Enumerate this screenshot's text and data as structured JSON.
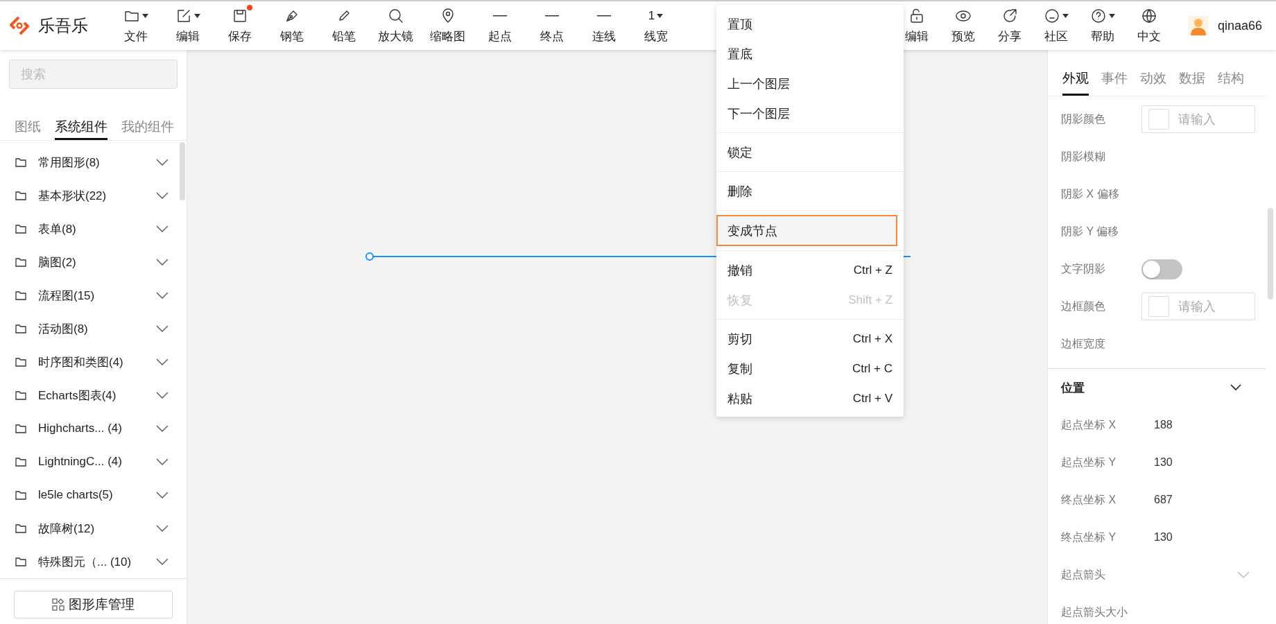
{
  "app": {
    "name": "乐吾乐"
  },
  "toolbar": {
    "left": [
      {
        "label": "文件",
        "caret": true,
        "dot": false
      },
      {
        "label": "编辑",
        "caret": true,
        "dot": false
      },
      {
        "label": "保存",
        "caret": false,
        "dot": true
      },
      {
        "label": "钢笔",
        "caret": false,
        "dot": false
      },
      {
        "label": "铅笔",
        "caret": false,
        "dot": false
      },
      {
        "label": "放大镜",
        "caret": false,
        "dot": false
      },
      {
        "label": "缩略图",
        "caret": false,
        "dot": false
      },
      {
        "label": "起点",
        "caret": false,
        "dot": false
      },
      {
        "label": "终点",
        "caret": false,
        "dot": false
      },
      {
        "label": "连线",
        "caret": false,
        "dot": false
      },
      {
        "label": "线宽",
        "value": "1",
        "caret": true,
        "dot": false
      }
    ],
    "right": [
      {
        "label": "编辑",
        "caret": false,
        "dot": false
      },
      {
        "label": "预览",
        "caret": false,
        "dot": false
      },
      {
        "label": "分享",
        "caret": false,
        "dot": false
      },
      {
        "label": "社区",
        "caret": true,
        "dot": false
      },
      {
        "label": "帮助",
        "caret": true,
        "dot": false
      },
      {
        "label": "中文",
        "caret": false,
        "dot": false
      }
    ],
    "user": {
      "name": "qinaa66"
    }
  },
  "sidebar": {
    "search": {
      "placeholder": "搜索"
    },
    "tabs": [
      {
        "label": "图纸",
        "selected": false
      },
      {
        "label": "系统组件",
        "selected": true
      },
      {
        "label": "我的组件",
        "selected": false
      }
    ],
    "items": [
      {
        "label": "常用图形(8)",
        "expanded": false
      },
      {
        "label": "基本形状(22)",
        "expanded": false
      },
      {
        "label": "表单(8)",
        "expanded": false
      },
      {
        "label": "脑图(2)",
        "expanded": false
      },
      {
        "label": "流程图(15)",
        "expanded": false
      },
      {
        "label": "活动图(8)",
        "expanded": false
      },
      {
        "label": "时序图和类图(4)",
        "expanded": false
      },
      {
        "label": "Echarts图表(4)",
        "expanded": false
      },
      {
        "label": "Highcharts... (4)",
        "expanded": false
      },
      {
        "label": "LightningC... (4)",
        "expanded": false
      },
      {
        "label": "le5le charts(5)",
        "expanded": false
      },
      {
        "label": "故障树(12)",
        "expanded": false
      },
      {
        "label": "特殊图元（... (10)",
        "expanded": false
      }
    ],
    "manage_button": {
      "label": "图形库管理"
    }
  },
  "context_menu": {
    "groups": [
      [
        {
          "label": "置顶",
          "disabled": false,
          "highlighted": false
        },
        {
          "label": "置底",
          "disabled": false,
          "highlighted": false
        },
        {
          "label": "上一个图层",
          "disabled": false,
          "highlighted": false
        },
        {
          "label": "下一个图层",
          "disabled": false,
          "highlighted": false
        }
      ],
      [
        {
          "label": "锁定",
          "disabled": false,
          "highlighted": false
        }
      ],
      [
        {
          "label": "删除",
          "disabled": false,
          "highlighted": false
        }
      ],
      [
        {
          "label": "变成节点",
          "disabled": false,
          "highlighted": true
        }
      ],
      [
        {
          "label": "撤销",
          "shortcut": "Ctrl + Z",
          "disabled": false,
          "highlighted": false
        },
        {
          "label": "恢复",
          "shortcut": "Shift + Z",
          "disabled": true,
          "highlighted": false
        }
      ],
      [
        {
          "label": "剪切",
          "shortcut": "Ctrl + X",
          "disabled": false,
          "highlighted": false
        },
        {
          "label": "复制",
          "shortcut": "Ctrl + C",
          "disabled": false,
          "highlighted": false
        },
        {
          "label": "粘贴",
          "shortcut": "Ctrl + V",
          "disabled": false,
          "highlighted": false
        }
      ]
    ]
  },
  "properties": {
    "tabs": [
      {
        "label": "外观",
        "selected": true
      },
      {
        "label": "事件",
        "selected": false
      },
      {
        "label": "动效",
        "selected": false
      },
      {
        "label": "数据",
        "selected": false
      },
      {
        "label": "结构",
        "selected": false
      }
    ],
    "rows": [
      {
        "kind": "color",
        "label": "阴影颜色",
        "placeholder": "请输入"
      },
      {
        "kind": "empty",
        "label": "阴影模糊"
      },
      {
        "kind": "empty",
        "label": "阴影 X 偏移"
      },
      {
        "kind": "empty",
        "label": "阴影 Y 偏移"
      },
      {
        "kind": "toggle",
        "label": "文字阴影",
        "on": false
      },
      {
        "kind": "color",
        "label": "边框颜色",
        "placeholder": "请输入"
      },
      {
        "kind": "empty",
        "label": "边框宽度"
      }
    ],
    "section": {
      "title": "位置",
      "expanded": true,
      "rows": [
        {
          "kind": "value",
          "label": "起点坐标 X",
          "value": "188"
        },
        {
          "kind": "value",
          "label": "起点坐标 Y",
          "value": "130"
        },
        {
          "kind": "value",
          "label": "终点坐标 X",
          "value": "687"
        },
        {
          "kind": "value",
          "label": "终点坐标 Y",
          "value": "130"
        },
        {
          "kind": "select",
          "label": "起点箭头"
        },
        {
          "kind": "empty",
          "label": "起点箭头大小"
        }
      ]
    }
  }
}
